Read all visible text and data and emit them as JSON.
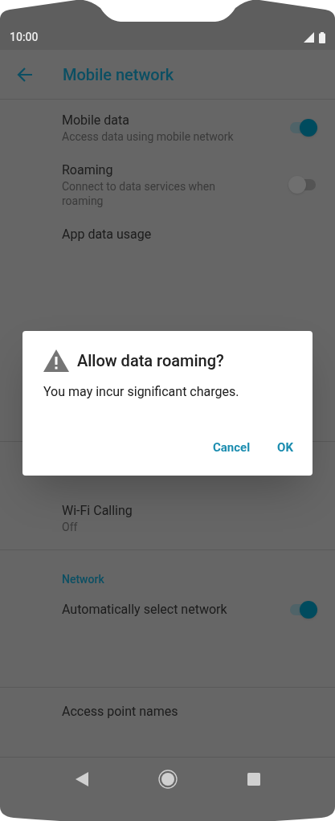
{
  "status_bar": {
    "time": "10:00"
  },
  "app_bar": {
    "title": "Mobile network"
  },
  "groups": [
    {
      "items": [
        {
          "kind": "toggle",
          "title": "Mobile data",
          "summary": "Access data using mobile network",
          "on": true
        },
        {
          "kind": "toggle",
          "title": "Roaming",
          "summary": "Connect to data services when roaming",
          "on": false
        },
        {
          "kind": "link",
          "title": "App data usage"
        }
      ]
    },
    {
      "items": [
        {
          "kind": "link",
          "title": "Wi-Fi Calling",
          "summary": "Off"
        }
      ]
    },
    {
      "header": "Network",
      "items": [
        {
          "kind": "toggle",
          "title": "Automatically select network",
          "on": true
        }
      ]
    },
    {
      "items": [
        {
          "kind": "link",
          "title": "Access point names"
        }
      ]
    }
  ],
  "dialog": {
    "title": "Allow data roaming?",
    "message": "You may incur significant charges.",
    "buttons": [
      "Cancel",
      "OK"
    ]
  }
}
